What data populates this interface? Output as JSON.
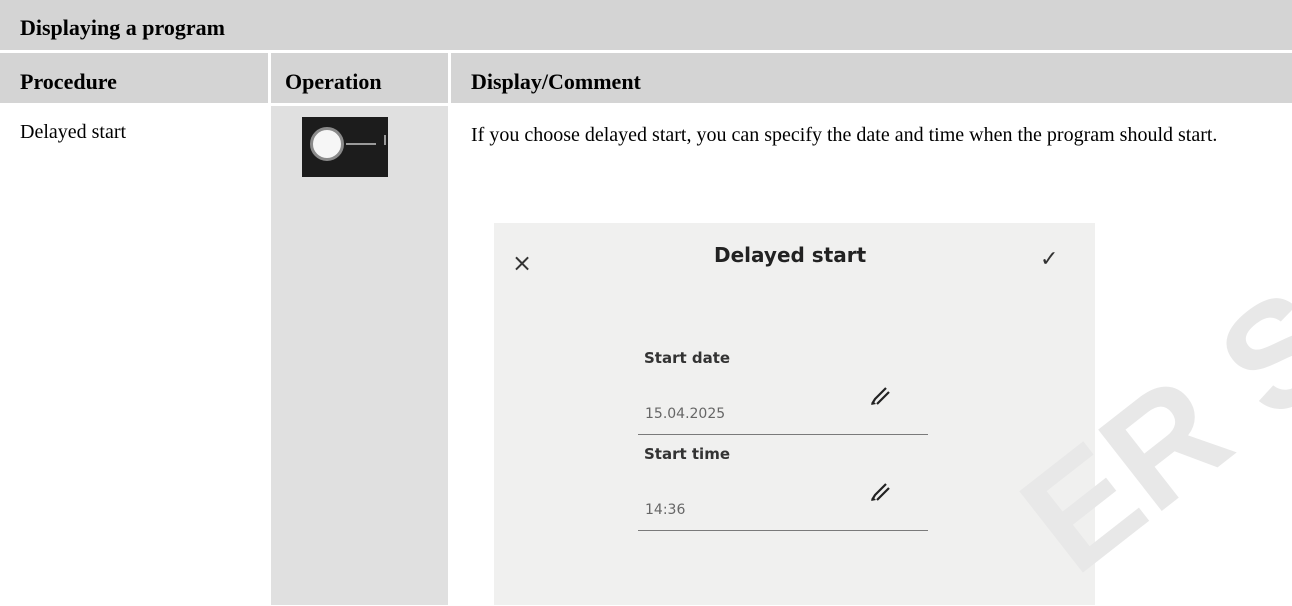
{
  "section_title": "Displaying a program",
  "table": {
    "headers": {
      "procedure": "Procedure",
      "operation": "Operation",
      "display_comment": "Display/Comment"
    },
    "rows": [
      {
        "procedure": "Delayed start",
        "operation_icon": "delayed-start-toggle-icon",
        "comment": "If you choose delayed start, you can specify the date and time when the program should start."
      }
    ]
  },
  "dialog": {
    "title": "Delayed start",
    "close_icon": "×",
    "confirm_icon": "✓",
    "fields": [
      {
        "label": "Start date",
        "value": "15.04.2025",
        "icon": "pencil-edit-icon"
      },
      {
        "label": "Start time",
        "value": "14:36",
        "icon": "pencil-edit-icon"
      }
    ]
  },
  "watermark": "ER SAS"
}
